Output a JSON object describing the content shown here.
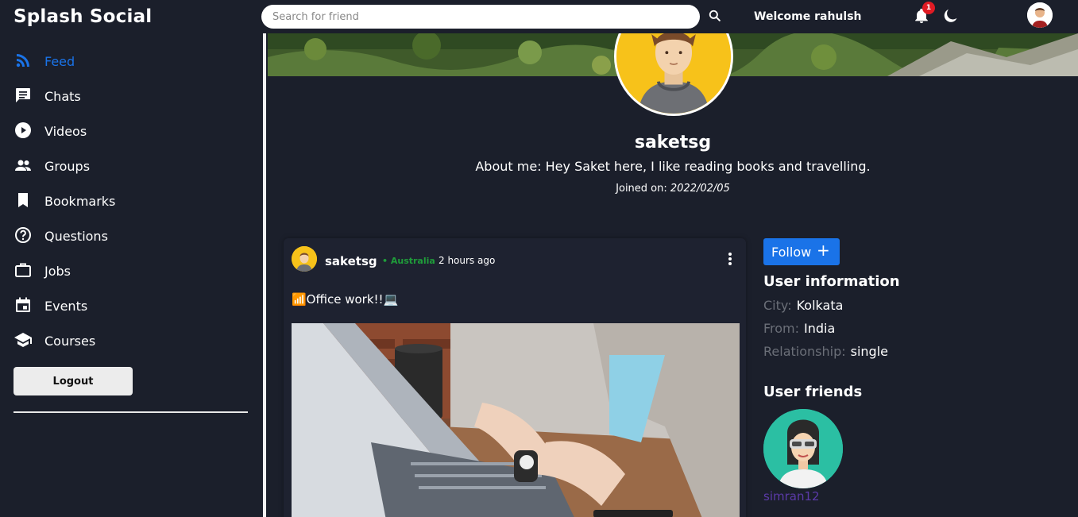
{
  "app": {
    "title": "Splash Social"
  },
  "header": {
    "search_placeholder": "Search for friend",
    "welcome": "Welcome rahulsh",
    "notifications_count": "1"
  },
  "sidebar": {
    "items": [
      {
        "label": "Feed",
        "icon": "rss-icon",
        "active": true
      },
      {
        "label": "Chats",
        "icon": "chat-icon"
      },
      {
        "label": "Videos",
        "icon": "play-circle-icon"
      },
      {
        "label": "Groups",
        "icon": "group-icon"
      },
      {
        "label": "Bookmarks",
        "icon": "bookmark-icon"
      },
      {
        "label": "Questions",
        "icon": "help-circle-icon"
      },
      {
        "label": "Jobs",
        "icon": "briefcase-icon"
      },
      {
        "label": "Events",
        "icon": "calendar-icon"
      },
      {
        "label": "Courses",
        "icon": "school-icon"
      }
    ],
    "logout_label": "Logout"
  },
  "profile": {
    "username": "saketsg",
    "about": "About me: Hey Saket here, I like reading books and travelling.",
    "joined_label": "Joined on:",
    "joined_date": "2022/02/05"
  },
  "post": {
    "username": "saketsg",
    "location": "• Australia",
    "time": "2 hours ago",
    "text": "📶Office work!!💻"
  },
  "follow_label": "Follow",
  "user_info": {
    "title": "User information",
    "rows": [
      {
        "key": "City:",
        "value": "Kolkata"
      },
      {
        "key": "From:",
        "value": "India"
      },
      {
        "key": "Relationship:",
        "value": "single"
      }
    ]
  },
  "friends": {
    "title": "User friends",
    "items": [
      {
        "name": "simran12"
      }
    ]
  },
  "colors": {
    "background": "#1b1f2b",
    "accent": "#1a73e8",
    "location_green": "#1f9d3a",
    "badge_red": "#e01b24",
    "friend_link": "#5b3aa8"
  }
}
